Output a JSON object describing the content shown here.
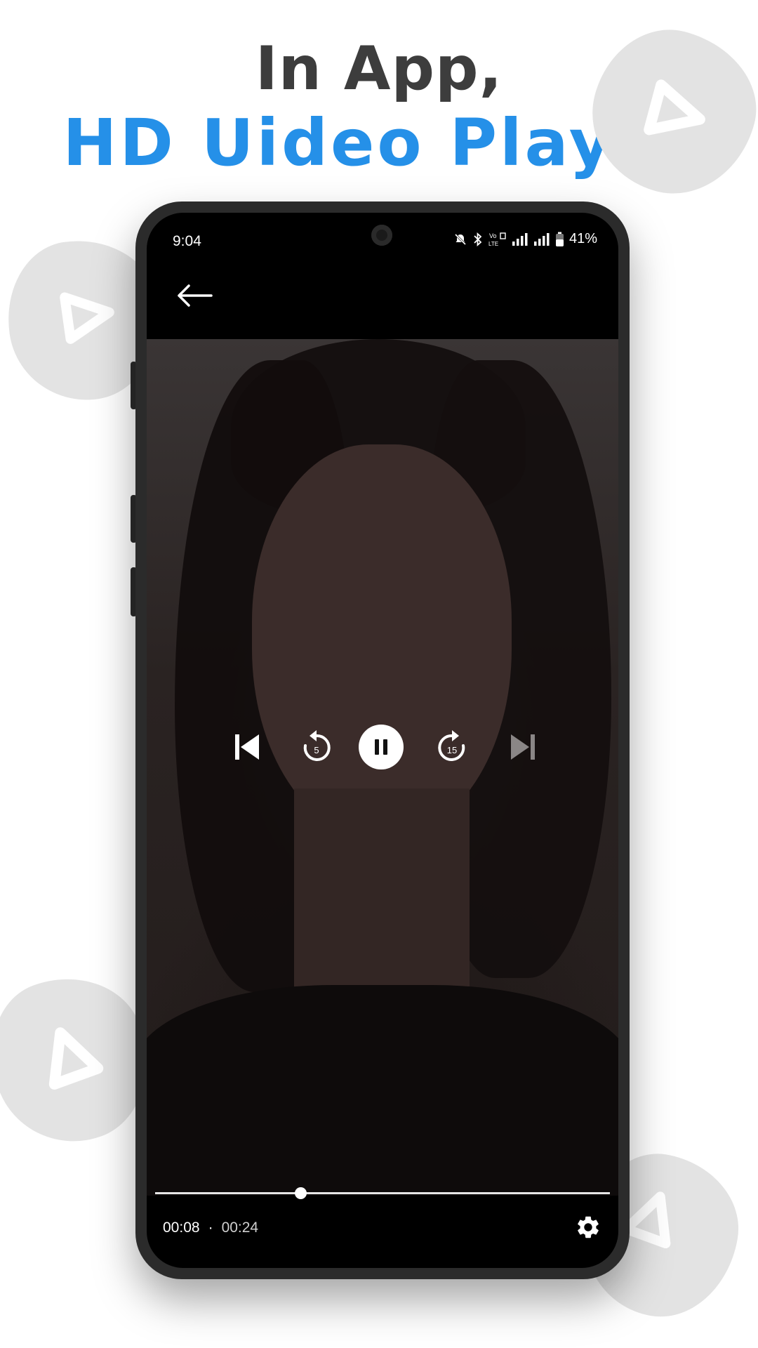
{
  "promo": {
    "line1": "In App,",
    "line2": "HD Uideo Player",
    "line1_color": "#3d3d3d",
    "line2_color": "#2590e8"
  },
  "status_bar": {
    "time": "9:04",
    "battery": "41%",
    "icons": [
      "mute-icon",
      "bluetooth-icon",
      "volte-icon",
      "signal-icon",
      "signal-icon",
      "battery-icon"
    ]
  },
  "player": {
    "current_time": "00:08",
    "separator": "·",
    "total_time": "00:24",
    "progress": 0.32,
    "rewind_seconds": "5",
    "forward_seconds": "15",
    "state": "playing"
  }
}
